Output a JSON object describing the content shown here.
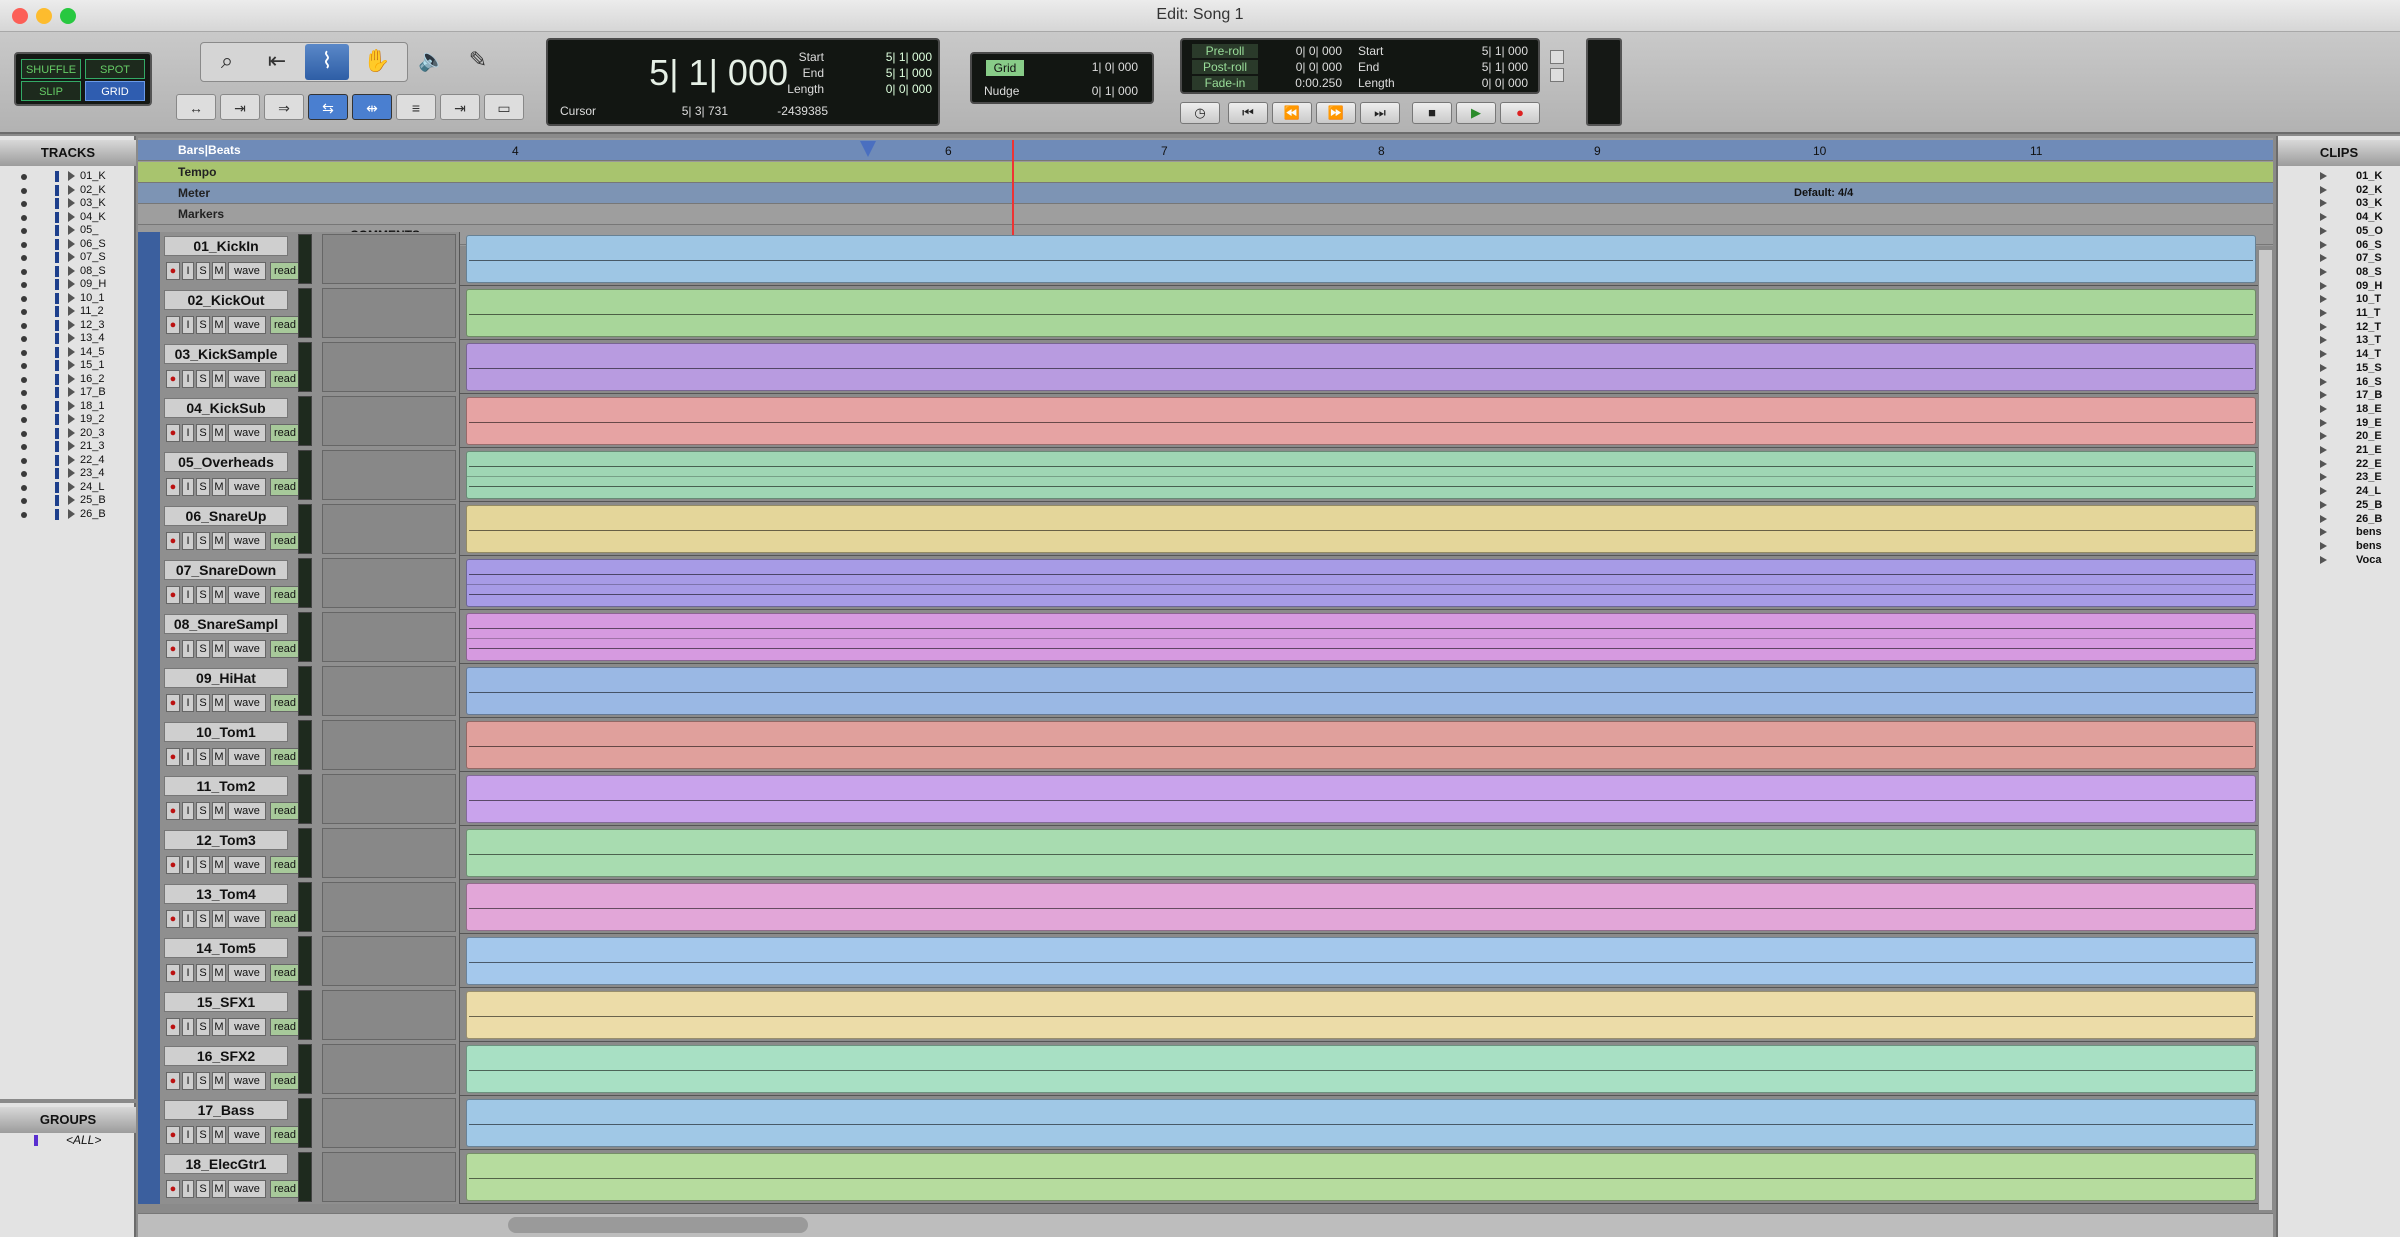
{
  "window": {
    "title": "Edit: Song 1"
  },
  "modes": {
    "shuffle": "SHUFFLE",
    "spot": "SPOT",
    "slip": "SLIP",
    "grid": "GRID"
  },
  "counter": {
    "main": "5| 1| 000",
    "cursor_label": "Cursor",
    "cursor_value": "5| 3| 731",
    "cursor_sample": "-2439385",
    "start_label": "Start",
    "start": "5| 1| 000",
    "end_label": "End",
    "end": "5| 1| 000",
    "length_label": "Length",
    "length": "0| 0| 000"
  },
  "grid": {
    "grid_label": "Grid",
    "grid_value": "1| 0| 000",
    "nudge_label": "Nudge",
    "nudge_value": "0| 1| 000"
  },
  "transport_counter": {
    "preroll_label": "Pre-roll",
    "preroll": "0| 0| 000",
    "postroll_label": "Post-roll",
    "postroll": "0| 0| 000",
    "fadein_label": "Fade-in",
    "fadein": "0:00.250",
    "start_label": "Start",
    "start": "5| 1| 000",
    "end_label": "End",
    "end": "5| 1| 000",
    "length_label": "Length",
    "length": "0| 0| 000"
  },
  "tracks_panel": {
    "title": "TRACKS",
    "items": [
      "01_K",
      "02_K",
      "03_K",
      "04_K",
      "05_",
      "06_S",
      "07_S",
      "08_S",
      "09_H",
      "10_1",
      "11_2",
      "12_3",
      "13_4",
      "14_5",
      "15_1",
      "16_2",
      "17_B",
      "18_1",
      "19_2",
      "20_3",
      "21_3",
      "22_4",
      "23_4",
      "24_L",
      "25_B",
      "26_B"
    ]
  },
  "groups_panel": {
    "title": "GROUPS",
    "all": "<ALL>"
  },
  "rulers": {
    "bars_label": "Bars|Beats",
    "tempo_label": "Tempo",
    "meter_label": "Meter",
    "markers_label": "Markers",
    "meter_value": "Default: 4/4",
    "bar_numbers": [
      "4",
      "6",
      "7",
      "8",
      "9",
      "10",
      "11"
    ]
  },
  "comments_label": "COMMENTS",
  "track_buttons": {
    "rec": "●",
    "input": "I",
    "solo": "S",
    "mute": "M",
    "view": "wave",
    "auto": "read"
  },
  "tracks": [
    {
      "name": "01_KickIn",
      "color": "#9ec6e4"
    },
    {
      "name": "02_KickOut",
      "color": "#a8d69a"
    },
    {
      "name": "03_KickSample",
      "color": "#b89be0"
    },
    {
      "name": "04_KickSub",
      "color": "#e6a3a3"
    },
    {
      "name": "05_Overheads",
      "color": "#9fd6b4"
    },
    {
      "name": "06_SnareUp",
      "color": "#e4d69a"
    },
    {
      "name": "07_SnareDown",
      "color": "#a79be6"
    },
    {
      "name": "08_SnareSampl",
      "color": "#d69ae0"
    },
    {
      "name": "09_HiHat",
      "color": "#9ab8e4"
    },
    {
      "name": "10_Tom1",
      "color": "#e0a09c"
    },
    {
      "name": "11_Tom2",
      "color": "#c9a3ec"
    },
    {
      "name": "12_Tom3",
      "color": "#a8dcb0"
    },
    {
      "name": "13_Tom4",
      "color": "#e2a6d8"
    },
    {
      "name": "14_Tom5",
      "color": "#a4c8ec"
    },
    {
      "name": "15_SFX1",
      "color": "#ecdca8"
    },
    {
      "name": "16_SFX2",
      "color": "#a8e0c4"
    },
    {
      "name": "17_Bass",
      "color": "#a0c8e6"
    },
    {
      "name": "18_ElecGtr1",
      "color": "#b6dc9e"
    }
  ],
  "clips_panel": {
    "title": "CLIPS",
    "items": [
      "01_K",
      "02_K",
      "03_K",
      "04_K",
      "05_O",
      "06_S",
      "07_S",
      "08_S",
      "09_H",
      "10_T",
      "11_T",
      "12_T",
      "13_T",
      "14_T",
      "15_S",
      "16_S",
      "17_B",
      "18_E",
      "19_E",
      "20_E",
      "21_E",
      "22_E",
      "23_E",
      "24_L",
      "25_B",
      "26_B",
      "bens",
      "bens",
      "Voca"
    ]
  }
}
